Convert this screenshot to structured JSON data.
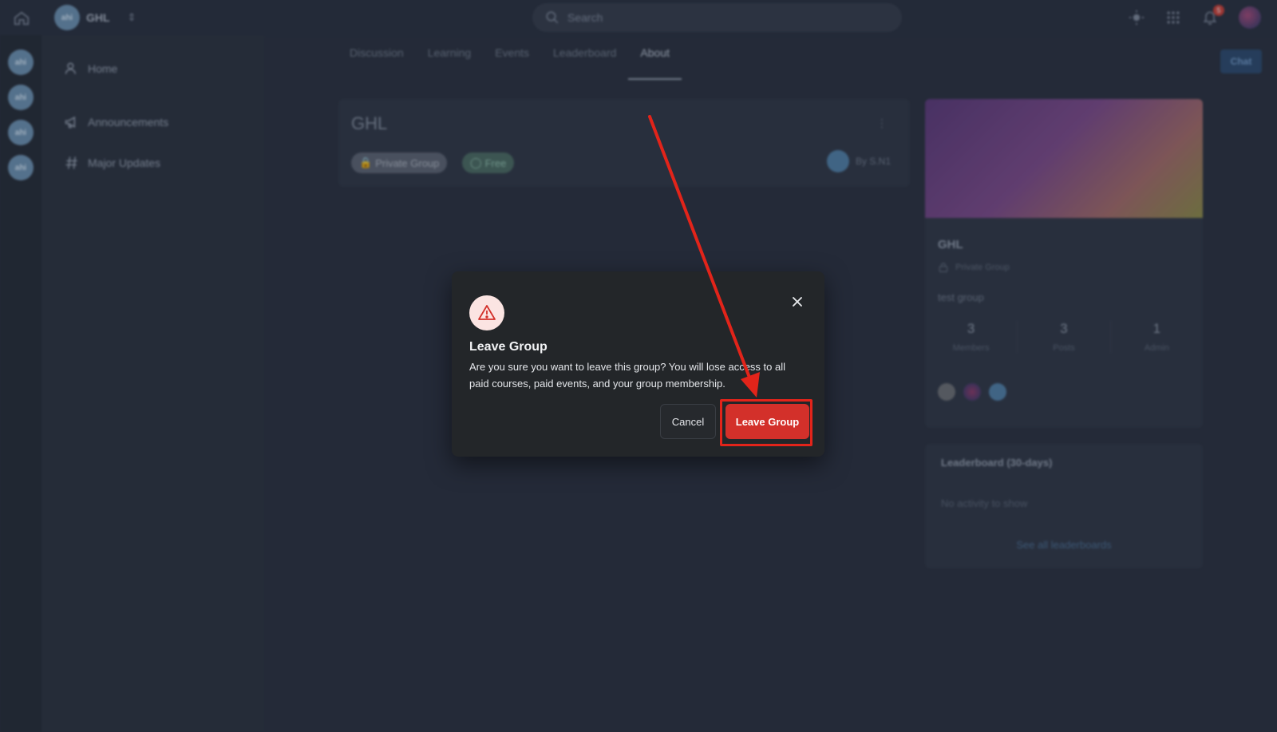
{
  "topbar": {
    "group_avatar_text": "ahi",
    "group_name": "GHL",
    "search_placeholder": "Search",
    "notification_count": "5"
  },
  "rail": {
    "avatars": [
      "ahi",
      "ahi",
      "ahi",
      "ahi"
    ]
  },
  "sidebar": {
    "items": [
      {
        "label": "Home",
        "icon": "user-icon"
      },
      {
        "label": "Announcements",
        "icon": "megaphone-icon"
      },
      {
        "label": "Major Updates",
        "icon": "hash-icon"
      }
    ]
  },
  "tabs": [
    {
      "label": "Discussion"
    },
    {
      "label": "Learning"
    },
    {
      "label": "Events"
    },
    {
      "label": "Leaderboard"
    },
    {
      "label": "About",
      "active": true
    }
  ],
  "chat_label": "Chat",
  "about": {
    "title": "GHL",
    "private_pill": "Private Group",
    "free_pill": "Free",
    "by_line": "By S.N1"
  },
  "group_card": {
    "name": "GHL",
    "privacy": "Private Group",
    "description": "test group",
    "stats": [
      {
        "value": "3",
        "label": "Members"
      },
      {
        "value": "3",
        "label": "Posts"
      },
      {
        "value": "1",
        "label": "Admin"
      }
    ]
  },
  "leaderboard": {
    "title": "Leaderboard (30-days)",
    "empty": "No activity to show",
    "link": "See all leaderboards"
  },
  "modal": {
    "title": "Leave Group",
    "body": "Are you sure you want to leave this group? You will lose access to all paid courses, paid events, and your group membership.",
    "cancel_label": "Cancel",
    "confirm_label": "Leave Group"
  },
  "colors": {
    "danger": "#d3302a",
    "annotation": "#e2241a",
    "background": "#2a3140"
  }
}
